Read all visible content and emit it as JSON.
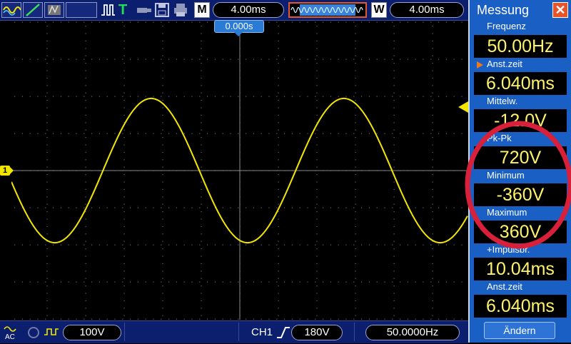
{
  "colors": {
    "trace": "#f2e600",
    "panel": "#1a5fc4",
    "topbar": "#0c1e6e",
    "value_text": "#fff36a",
    "highlight": "#d8203a",
    "trigger_marker": "#2a7bd6"
  },
  "toolbar": {
    "run_mode_letter": "T",
    "timebase": "4.00ms",
    "main_letter": "M",
    "window_letter": "W",
    "window_timebase": "4.00ms"
  },
  "trigger_position": "0.000s",
  "channel_marker": "1",
  "bottom": {
    "coupling": "AC",
    "channel_scale": "100V",
    "trigger_source": "CH1",
    "trigger_level": "180V",
    "frequency": "50.0000Hz"
  },
  "panel": {
    "title": "Messung",
    "measurements": [
      {
        "label": "Frequenz",
        "value": "50.00Hz"
      },
      {
        "label": "Anst.zeit",
        "value": "6.040ms"
      },
      {
        "label": "Mittelw.",
        "value": "-12.0V"
      },
      {
        "label": "Pk-Pk",
        "value": "720V"
      },
      {
        "label": "Minimum",
        "value": "-360V"
      },
      {
        "label": "Maximum",
        "value": "360V"
      },
      {
        "label": "+Impulsbr.",
        "value": "10.04ms"
      },
      {
        "label": "Anst.zeit",
        "value": "6.040ms"
      }
    ],
    "change_button": "Ändern"
  },
  "chart_data": {
    "type": "line",
    "series": [
      {
        "waveform": "sine",
        "frequency_hz": 50,
        "amplitude_v": 360,
        "offset_v": 0
      }
    ],
    "x_div_ms": 4,
    "y_div_v": 100,
    "cycles_shown": 3.2
  }
}
